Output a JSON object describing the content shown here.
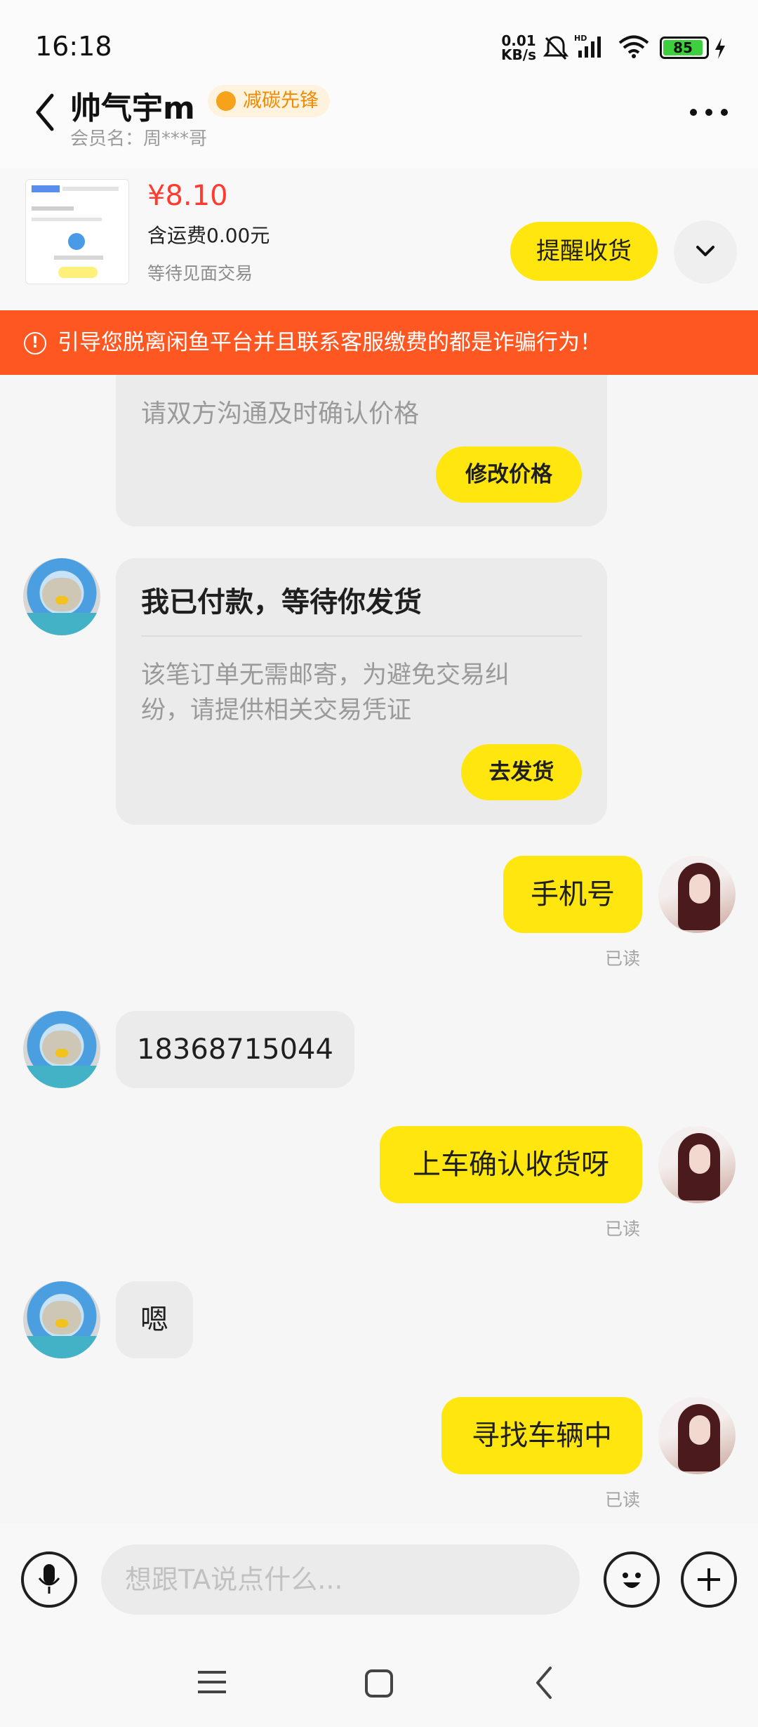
{
  "status": {
    "time": "16:18",
    "net_speed_value": "0.01",
    "net_speed_unit": "KB/s",
    "battery": "85"
  },
  "header": {
    "title": "帅气宇m",
    "badge": "减碳先锋",
    "member": "会员名：周***哥"
  },
  "order": {
    "price": "¥8.10",
    "shipping": "含运费0.00元",
    "state": "等待见面交易",
    "remind_button": "提醒收货"
  },
  "warning": "引导您脱离闲鱼平台并且联系客服缴费的都是诈骗行为！",
  "messages": {
    "card1": {
      "text": "请双方沟通及时确认价格",
      "button": "修改价格"
    },
    "card2": {
      "title": "我已付款，等待你发货",
      "text_line1": "该笔订单无需邮寄，为避免交易纠",
      "text_line2": "纷，请提供相关交易凭证",
      "button": "去发货"
    },
    "m1": {
      "text": "手机号",
      "status": "已读"
    },
    "m2": {
      "text": "18368715044"
    },
    "m3": {
      "text": "上车确认收货呀",
      "status": "已读"
    },
    "m4": {
      "text": "嗯"
    },
    "m5": {
      "text": "寻找车辆中",
      "status": "已读"
    }
  },
  "input": {
    "placeholder": "想跟TA说点什么..."
  },
  "colors": {
    "accent": "#ffe60f",
    "warning": "#ff5722",
    "price": "#ff3b30"
  }
}
